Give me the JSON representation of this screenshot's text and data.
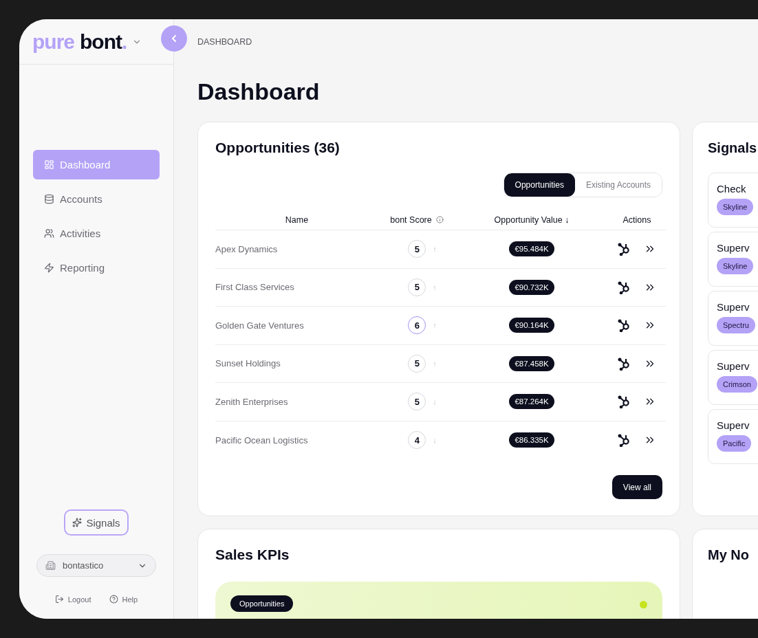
{
  "sidebar": {
    "logo": {
      "light": "pure",
      "dark": "bont",
      "dot": "."
    },
    "nav": [
      {
        "label": "Dashboard",
        "selected": true
      },
      {
        "label": "Accounts",
        "selected": false
      },
      {
        "label": "Activities",
        "selected": false
      },
      {
        "label": "Reporting",
        "selected": false
      }
    ],
    "signals_button": "Signals",
    "workspace": "bontastico",
    "footer": [
      {
        "label": "Logout"
      },
      {
        "label": "Help"
      }
    ]
  },
  "breadcrumb": "DASHBOARD",
  "title": "Dashboard",
  "opportunities": {
    "title": "Opportunities (36)",
    "tabs": [
      {
        "label": "Opportunities",
        "selected": true
      },
      {
        "label": "Existing Accounts",
        "selected": false
      }
    ],
    "columns": [
      "Name",
      "bont Score",
      "Opportunity Value ↓",
      "Actions"
    ],
    "rows": [
      {
        "name": "Apex Dynamics",
        "score": "5",
        "highlighted": false,
        "trend": "↑",
        "value": "€95.484K"
      },
      {
        "name": "First Class Services",
        "score": "5",
        "highlighted": false,
        "trend": "↑",
        "value": "€90.732K"
      },
      {
        "name": "Golden Gate Ventures",
        "score": "6",
        "highlighted": true,
        "trend": "↑",
        "value": "€90.164K"
      },
      {
        "name": "Sunset Holdings",
        "score": "5",
        "highlighted": false,
        "trend": "↑",
        "value": "€87.458K"
      },
      {
        "name": "Zenith Enterprises",
        "score": "5",
        "highlighted": false,
        "trend": "↓",
        "value": "€87.264K"
      },
      {
        "name": "Pacific Ocean Logistics",
        "score": "4",
        "highlighted": false,
        "trend": "↓",
        "value": "€86.335K"
      }
    ],
    "view_all": "View all"
  },
  "signals": {
    "title": "Signals",
    "items": [
      {
        "title": "Check",
        "tag": "Skyline"
      },
      {
        "title": "Superv",
        "tag": "Skyline"
      },
      {
        "title": "Superv",
        "tag": "Spectru"
      },
      {
        "title": "Superv",
        "tag": "Crimson"
      },
      {
        "title": "Superv",
        "tag": "Pacific"
      }
    ]
  },
  "sales_kpis": {
    "title": "Sales KPIs",
    "pill": "Opportunities"
  },
  "notes": {
    "title": "My No"
  }
}
